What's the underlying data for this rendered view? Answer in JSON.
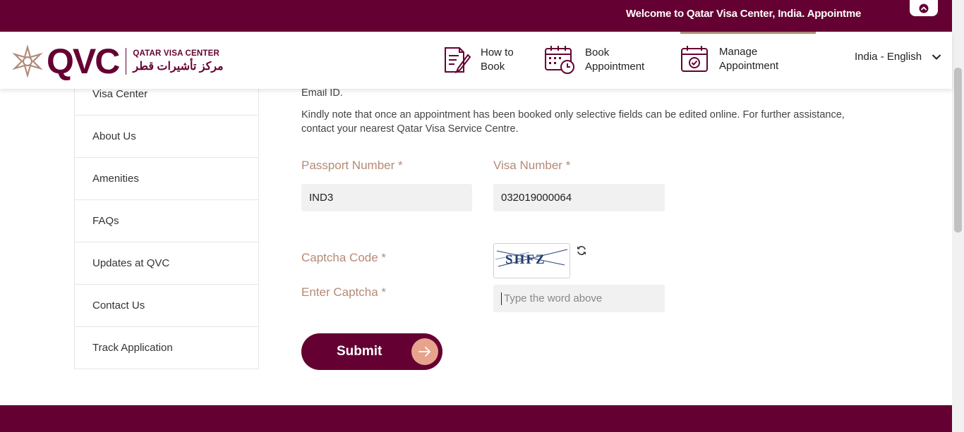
{
  "topbar": {
    "marquee": "Welcome to Qatar Visa Center, India. Appointme"
  },
  "logo": {
    "mark": "QVC",
    "title_en": "QATAR VISA CENTER",
    "title_ar": "مركز تأشيرات قطر"
  },
  "nav": [
    {
      "line1": "How to",
      "line2": "Book"
    },
    {
      "line1": "Book",
      "line2": "Appointment"
    },
    {
      "line1": "Manage",
      "line2": "Appointment"
    }
  ],
  "language": "India - English",
  "sidebar": {
    "items": [
      {
        "label": "Visa Center"
      },
      {
        "label": "About Us"
      },
      {
        "label": "Amenities"
      },
      {
        "label": "FAQs"
      },
      {
        "label": "Updates at QVC"
      },
      {
        "label": "Contact Us"
      },
      {
        "label": "Track Application"
      }
    ]
  },
  "main": {
    "note_top": "Email ID.",
    "note": "Kindly note that once an appointment has been booked only selective fields can be edited online. For further assistance, contact your nearest Qatar Visa Service Centre.",
    "passport_label": "Passport Number *",
    "passport_value": "IND3",
    "visa_label": "Visa Number *",
    "visa_value": "032019000064",
    "captcha_label": "Captcha Code *",
    "captcha_text": "SHFZ",
    "enter_captcha_label": "Enter Captcha *",
    "captcha_placeholder": "Type the word above",
    "submit_label": "Submit"
  },
  "colors": {
    "brand": "#650132",
    "label": "#b58a76",
    "accent": "#e7a38c"
  }
}
